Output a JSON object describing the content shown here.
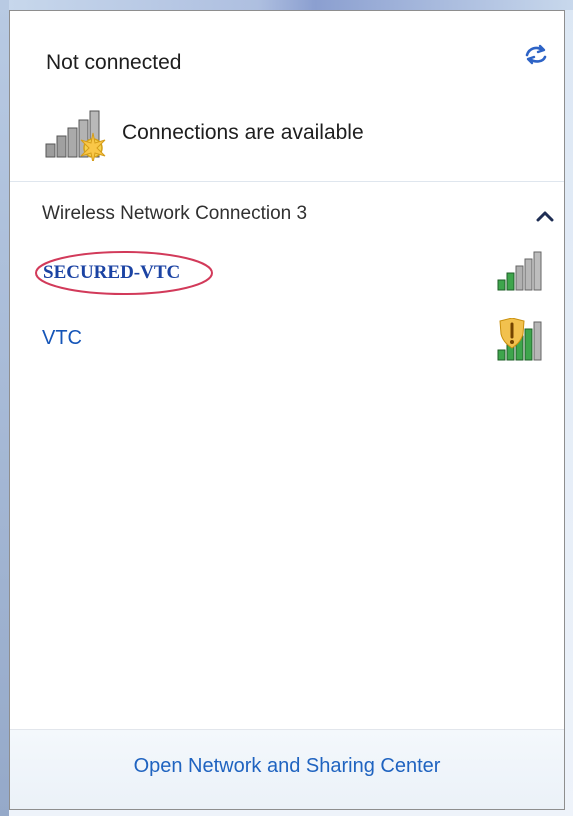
{
  "status": {
    "title": "Not connected",
    "availability_text": "Connections are available",
    "refresh_icon": "refresh-icon"
  },
  "group": {
    "title": "Wireless Network Connection 3",
    "chevron_icon": "chevron-up-icon"
  },
  "networks": [
    {
      "name": "SECURED-VTC",
      "highlighted": true,
      "signal_level": 0.5,
      "shield": false
    },
    {
      "name": "VTC",
      "highlighted": false,
      "signal_level": 0.8,
      "shield": true
    }
  ],
  "footer": {
    "link_label": "Open Network and Sharing Center"
  },
  "colors": {
    "link_blue": "#1555b8",
    "highlight_red": "#d23a5a",
    "signal_green": "#2f9e44",
    "signal_gray": "#9e9e9e",
    "warning_gold": "#f2c14e"
  }
}
